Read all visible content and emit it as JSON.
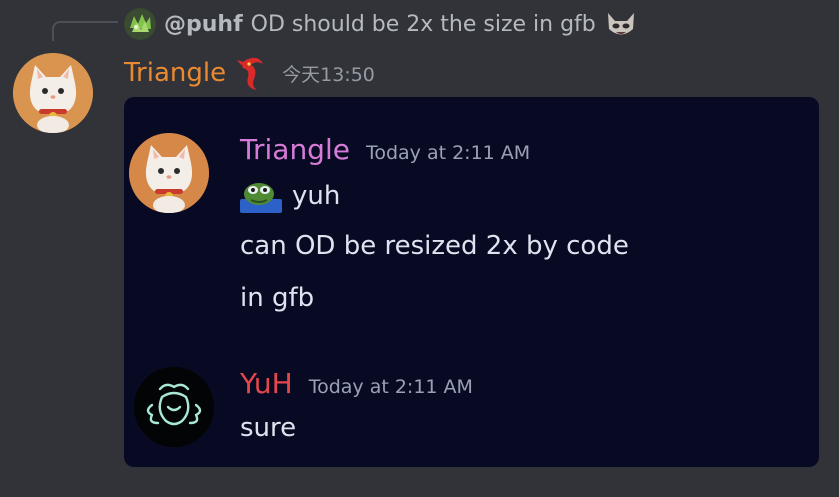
{
  "reply": {
    "author": "@puhf",
    "text": "OD should be 2x the size in gfb",
    "emoji": "cat-emoji"
  },
  "message": {
    "author": "Triangle",
    "timestamp": "今天13:50",
    "author_color": "#e98a32",
    "badge": "dragon-badge-icon"
  },
  "embed": {
    "background": "#080a24",
    "messages": [
      {
        "author": "Triangle",
        "timestamp": "Today at 2:11 AM",
        "author_color": "#d77bd8",
        "lines": [
          "yuh",
          "can OD be resized 2x by code",
          "in gfb"
        ],
        "emoji": "pepe-emoji"
      },
      {
        "author": "YuH",
        "timestamp": "Today at 2:11 AM",
        "author_color": "#e4484c",
        "lines": [
          "sure"
        ]
      }
    ]
  }
}
